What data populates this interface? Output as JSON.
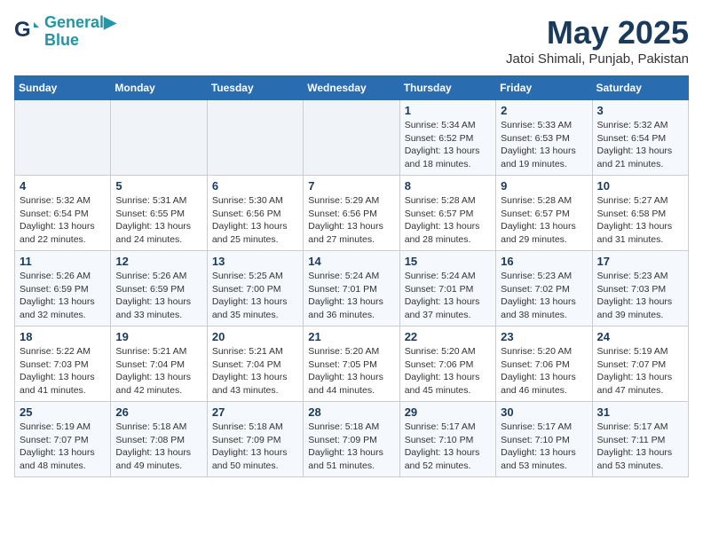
{
  "header": {
    "logo_line1": "General",
    "logo_line2": "Blue",
    "month_title": "May 2025",
    "subtitle": "Jatoi Shimali, Punjab, Pakistan"
  },
  "days_of_week": [
    "Sunday",
    "Monday",
    "Tuesday",
    "Wednesday",
    "Thursday",
    "Friday",
    "Saturday"
  ],
  "weeks": [
    [
      {
        "day": "",
        "info": ""
      },
      {
        "day": "",
        "info": ""
      },
      {
        "day": "",
        "info": ""
      },
      {
        "day": "",
        "info": ""
      },
      {
        "day": "1",
        "info": "Sunrise: 5:34 AM\nSunset: 6:52 PM\nDaylight: 13 hours\nand 18 minutes."
      },
      {
        "day": "2",
        "info": "Sunrise: 5:33 AM\nSunset: 6:53 PM\nDaylight: 13 hours\nand 19 minutes."
      },
      {
        "day": "3",
        "info": "Sunrise: 5:32 AM\nSunset: 6:54 PM\nDaylight: 13 hours\nand 21 minutes."
      }
    ],
    [
      {
        "day": "4",
        "info": "Sunrise: 5:32 AM\nSunset: 6:54 PM\nDaylight: 13 hours\nand 22 minutes."
      },
      {
        "day": "5",
        "info": "Sunrise: 5:31 AM\nSunset: 6:55 PM\nDaylight: 13 hours\nand 24 minutes."
      },
      {
        "day": "6",
        "info": "Sunrise: 5:30 AM\nSunset: 6:56 PM\nDaylight: 13 hours\nand 25 minutes."
      },
      {
        "day": "7",
        "info": "Sunrise: 5:29 AM\nSunset: 6:56 PM\nDaylight: 13 hours\nand 27 minutes."
      },
      {
        "day": "8",
        "info": "Sunrise: 5:28 AM\nSunset: 6:57 PM\nDaylight: 13 hours\nand 28 minutes."
      },
      {
        "day": "9",
        "info": "Sunrise: 5:28 AM\nSunset: 6:57 PM\nDaylight: 13 hours\nand 29 minutes."
      },
      {
        "day": "10",
        "info": "Sunrise: 5:27 AM\nSunset: 6:58 PM\nDaylight: 13 hours\nand 31 minutes."
      }
    ],
    [
      {
        "day": "11",
        "info": "Sunrise: 5:26 AM\nSunset: 6:59 PM\nDaylight: 13 hours\nand 32 minutes."
      },
      {
        "day": "12",
        "info": "Sunrise: 5:26 AM\nSunset: 6:59 PM\nDaylight: 13 hours\nand 33 minutes."
      },
      {
        "day": "13",
        "info": "Sunrise: 5:25 AM\nSunset: 7:00 PM\nDaylight: 13 hours\nand 35 minutes."
      },
      {
        "day": "14",
        "info": "Sunrise: 5:24 AM\nSunset: 7:01 PM\nDaylight: 13 hours\nand 36 minutes."
      },
      {
        "day": "15",
        "info": "Sunrise: 5:24 AM\nSunset: 7:01 PM\nDaylight: 13 hours\nand 37 minutes."
      },
      {
        "day": "16",
        "info": "Sunrise: 5:23 AM\nSunset: 7:02 PM\nDaylight: 13 hours\nand 38 minutes."
      },
      {
        "day": "17",
        "info": "Sunrise: 5:23 AM\nSunset: 7:03 PM\nDaylight: 13 hours\nand 39 minutes."
      }
    ],
    [
      {
        "day": "18",
        "info": "Sunrise: 5:22 AM\nSunset: 7:03 PM\nDaylight: 13 hours\nand 41 minutes."
      },
      {
        "day": "19",
        "info": "Sunrise: 5:21 AM\nSunset: 7:04 PM\nDaylight: 13 hours\nand 42 minutes."
      },
      {
        "day": "20",
        "info": "Sunrise: 5:21 AM\nSunset: 7:04 PM\nDaylight: 13 hours\nand 43 minutes."
      },
      {
        "day": "21",
        "info": "Sunrise: 5:20 AM\nSunset: 7:05 PM\nDaylight: 13 hours\nand 44 minutes."
      },
      {
        "day": "22",
        "info": "Sunrise: 5:20 AM\nSunset: 7:06 PM\nDaylight: 13 hours\nand 45 minutes."
      },
      {
        "day": "23",
        "info": "Sunrise: 5:20 AM\nSunset: 7:06 PM\nDaylight: 13 hours\nand 46 minutes."
      },
      {
        "day": "24",
        "info": "Sunrise: 5:19 AM\nSunset: 7:07 PM\nDaylight: 13 hours\nand 47 minutes."
      }
    ],
    [
      {
        "day": "25",
        "info": "Sunrise: 5:19 AM\nSunset: 7:07 PM\nDaylight: 13 hours\nand 48 minutes."
      },
      {
        "day": "26",
        "info": "Sunrise: 5:18 AM\nSunset: 7:08 PM\nDaylight: 13 hours\nand 49 minutes."
      },
      {
        "day": "27",
        "info": "Sunrise: 5:18 AM\nSunset: 7:09 PM\nDaylight: 13 hours\nand 50 minutes."
      },
      {
        "day": "28",
        "info": "Sunrise: 5:18 AM\nSunset: 7:09 PM\nDaylight: 13 hours\nand 51 minutes."
      },
      {
        "day": "29",
        "info": "Sunrise: 5:17 AM\nSunset: 7:10 PM\nDaylight: 13 hours\nand 52 minutes."
      },
      {
        "day": "30",
        "info": "Sunrise: 5:17 AM\nSunset: 7:10 PM\nDaylight: 13 hours\nand 53 minutes."
      },
      {
        "day": "31",
        "info": "Sunrise: 5:17 AM\nSunset: 7:11 PM\nDaylight: 13 hours\nand 53 minutes."
      }
    ]
  ]
}
